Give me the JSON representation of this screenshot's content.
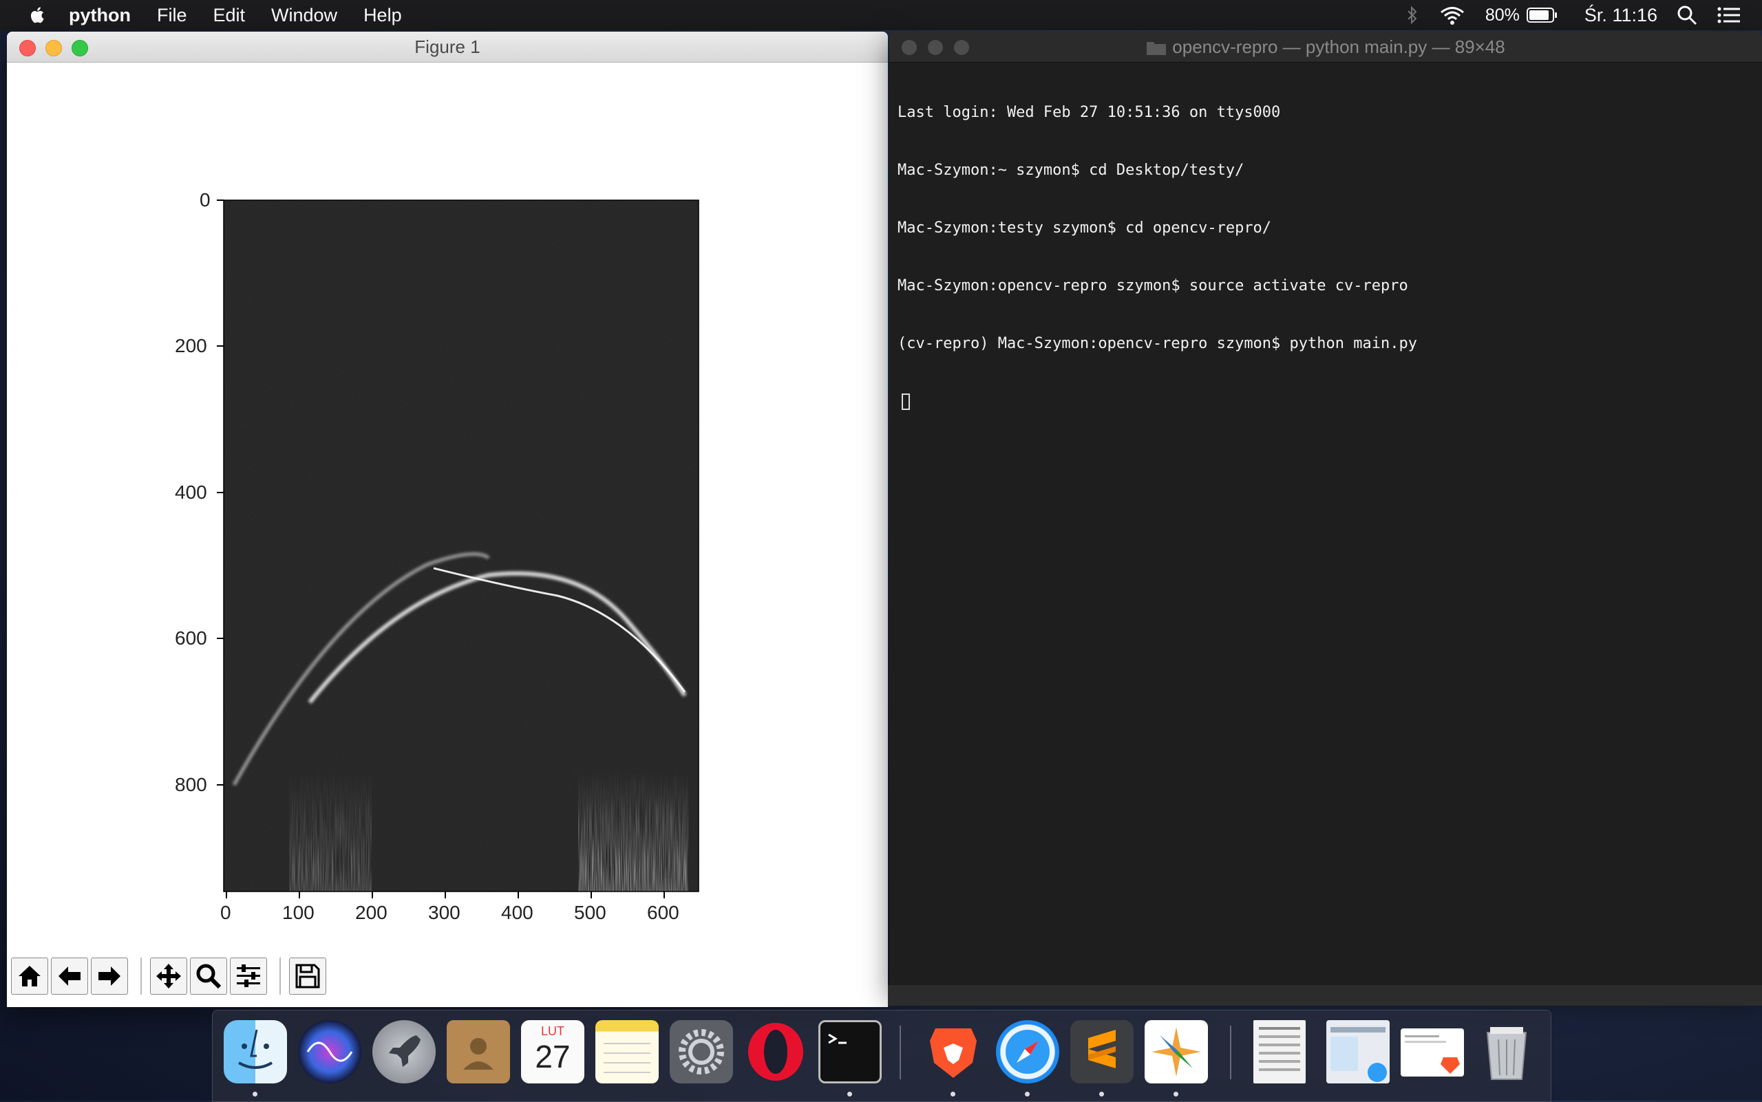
{
  "menubar": {
    "app_name": "python",
    "items": [
      "File",
      "Edit",
      "Window",
      "Help"
    ],
    "battery": "80%",
    "clock": "Śr. 11:16"
  },
  "figure": {
    "title": "Figure 1",
    "y_ticks": [
      "0",
      "200",
      "400",
      "600",
      "800"
    ],
    "x_ticks": [
      "0",
      "100",
      "200",
      "300",
      "400",
      "500",
      "600"
    ],
    "toolbar": [
      "home-icon",
      "back-icon",
      "forward-icon",
      "pan-icon",
      "zoom-icon",
      "configure-subplots-icon",
      "save-icon"
    ]
  },
  "terminal": {
    "title": "opencv-repro — python main.py — 89×48",
    "lines": [
      "Last login: Wed Feb 27 10:51:36 on ttys000",
      "Mac-Szymon:~ szymon$ cd Desktop/testy/",
      "Mac-Szymon:testy szymon$ cd opencv-repro/",
      "Mac-Szymon:opencv-repro szymon$ source activate cv-repro",
      "(cv-repro) Mac-Szymon:opencv-repro szymon$ python main.py"
    ]
  },
  "dock": {
    "apps": [
      "Finder",
      "Siri",
      "Launchpad",
      "Contacts",
      "Calendar",
      "Notes",
      "System Preferences",
      "Opera",
      "Terminal",
      "Brave",
      "Safari",
      "Sublime Text",
      "Python Launcher"
    ],
    "calendar_month": "LUT",
    "calendar_day": "27"
  }
}
